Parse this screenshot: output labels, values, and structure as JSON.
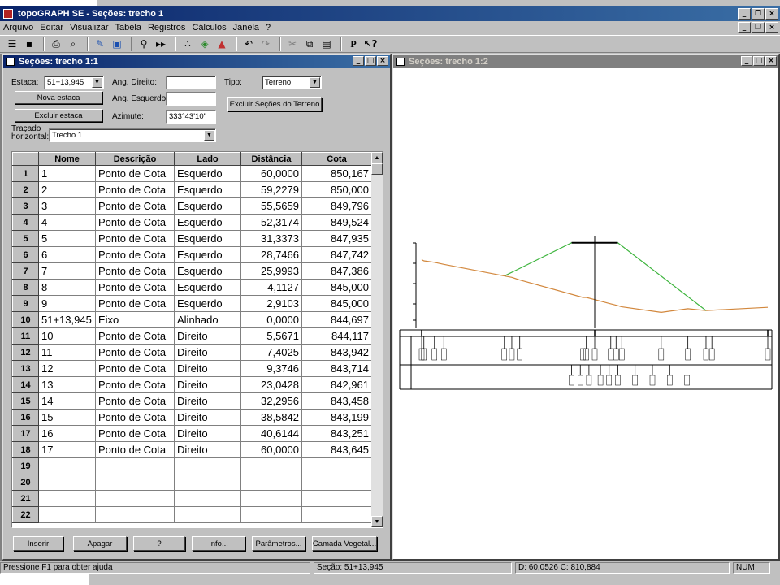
{
  "app": {
    "title": "topoGRAPH SE - Seções: trecho 1",
    "menu": [
      "Arquivo",
      "Editar",
      "Visualizar",
      "Tabela",
      "Registros",
      "Cálculos",
      "Janela",
      "?"
    ],
    "toolbar_icons": [
      "menu-icon",
      "save-icon",
      "print-icon",
      "preview-icon",
      "edit-icon",
      "book-icon",
      "find-icon",
      "find-next-icon",
      "points-icon",
      "3d-icon",
      "terrain-icon",
      "undo-icon",
      "redo-icon",
      "cut-icon",
      "copy-icon",
      "paste-icon",
      "properties-icon",
      "help-icon"
    ]
  },
  "left_window": {
    "title": "Seções: trecho 1:1",
    "estaca_label": "Estaca:",
    "estaca_value": "51+13,945",
    "ang_direito_label": "Ang. Direito:",
    "ang_direito_value": "",
    "ang_esquerdo_label": "Ang. Esquerdo:",
    "ang_esquerdo_value": "",
    "azimute_label": "Azimute:",
    "azimute_value": "333°43'10\"",
    "tipo_label": "Tipo:",
    "tipo_value": "Terreno",
    "nova_estaca": "Nova estaca",
    "excluir_estaca": "Excluir estaca",
    "excluir_secoes": "Excluir Seções do Terreno",
    "tracado_label": "Traçado horizontal:",
    "tracado_value": "Trecho 1",
    "columns": [
      "Nome",
      "Descrição",
      "Lado",
      "Distância",
      "Cota"
    ],
    "rows": [
      {
        "n": "1",
        "nome": "1",
        "desc": "Ponto de Cota",
        "lado": "Esquerdo",
        "dist": "60,0000",
        "cota": "850,167"
      },
      {
        "n": "2",
        "nome": "2",
        "desc": "Ponto de Cota",
        "lado": "Esquerdo",
        "dist": "59,2279",
        "cota": "850,000"
      },
      {
        "n": "3",
        "nome": "3",
        "desc": "Ponto de Cota",
        "lado": "Esquerdo",
        "dist": "55,5659",
        "cota": "849,796"
      },
      {
        "n": "4",
        "nome": "4",
        "desc": "Ponto de Cota",
        "lado": "Esquerdo",
        "dist": "52,3174",
        "cota": "849,524"
      },
      {
        "n": "5",
        "nome": "5",
        "desc": "Ponto de Cota",
        "lado": "Esquerdo",
        "dist": "31,3373",
        "cota": "847,935"
      },
      {
        "n": "6",
        "nome": "6",
        "desc": "Ponto de Cota",
        "lado": "Esquerdo",
        "dist": "28,7466",
        "cota": "847,742"
      },
      {
        "n": "7",
        "nome": "7",
        "desc": "Ponto de Cota",
        "lado": "Esquerdo",
        "dist": "25,9993",
        "cota": "847,386"
      },
      {
        "n": "8",
        "nome": "8",
        "desc": "Ponto de Cota",
        "lado": "Esquerdo",
        "dist": "4,1127",
        "cota": "845,000"
      },
      {
        "n": "9",
        "nome": "9",
        "desc": "Ponto de Cota",
        "lado": "Esquerdo",
        "dist": "2,9103",
        "cota": "845,000"
      },
      {
        "n": "10",
        "nome": "51+13,945",
        "desc": "Eixo",
        "lado": "Alinhado",
        "dist": "0,0000",
        "cota": "844,697"
      },
      {
        "n": "11",
        "nome": "10",
        "desc": "Ponto de Cota",
        "lado": "Direito",
        "dist": "5,5671",
        "cota": "844,117"
      },
      {
        "n": "12",
        "nome": "11",
        "desc": "Ponto de Cota",
        "lado": "Direito",
        "dist": "7,4025",
        "cota": "843,942"
      },
      {
        "n": "13",
        "nome": "12",
        "desc": "Ponto de Cota",
        "lado": "Direito",
        "dist": "9,3746",
        "cota": "843,714"
      },
      {
        "n": "14",
        "nome": "13",
        "desc": "Ponto de Cota",
        "lado": "Direito",
        "dist": "23,0428",
        "cota": "842,961"
      },
      {
        "n": "15",
        "nome": "14",
        "desc": "Ponto de Cota",
        "lado": "Direito",
        "dist": "32,2956",
        "cota": "843,458"
      },
      {
        "n": "16",
        "nome": "15",
        "desc": "Ponto de Cota",
        "lado": "Direito",
        "dist": "38,5842",
        "cota": "843,199"
      },
      {
        "n": "17",
        "nome": "16",
        "desc": "Ponto de Cota",
        "lado": "Direito",
        "dist": "40,6144",
        "cota": "843,251"
      },
      {
        "n": "18",
        "nome": "17",
        "desc": "Ponto de Cota",
        "lado": "Direito",
        "dist": "60,0000",
        "cota": "843,645"
      },
      {
        "n": "19",
        "nome": "",
        "desc": "",
        "lado": "",
        "dist": "",
        "cota": ""
      },
      {
        "n": "20",
        "nome": "",
        "desc": "",
        "lado": "",
        "dist": "",
        "cota": ""
      },
      {
        "n": "21",
        "nome": "",
        "desc": "",
        "lado": "",
        "dist": "",
        "cota": ""
      },
      {
        "n": "22",
        "nome": "",
        "desc": "",
        "lado": "",
        "dist": "",
        "cota": ""
      }
    ],
    "buttons": [
      "Inserir",
      "Apagar",
      "?",
      "Info...",
      "Parâmetros...",
      "Camada Vegetal..."
    ]
  },
  "right_window": {
    "title": "Seções: trecho 1:2",
    "colors": {
      "terrain": "#d2873c",
      "section": "#3cb43c"
    }
  },
  "status": {
    "help": "Pressione F1 para obter ajuda",
    "secao": "Seção: 51+13,945",
    "coords": "D: 60,0526 C: 810,884",
    "num": "NUM"
  }
}
